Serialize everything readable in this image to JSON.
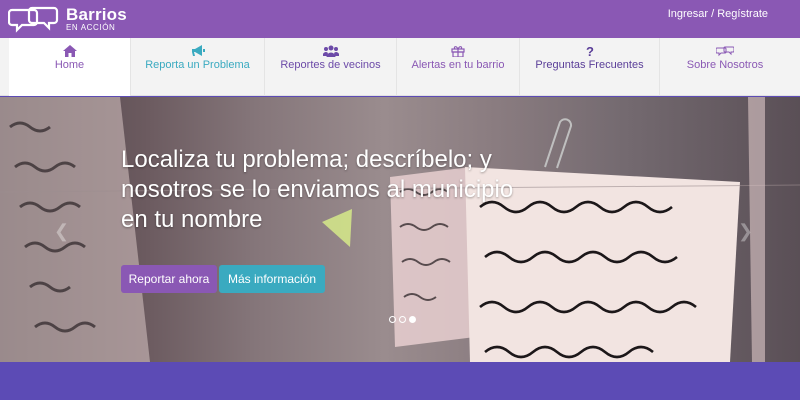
{
  "header": {
    "logo_name": "Barrios",
    "logo_sub": "EN ACCIÓN",
    "auth_link": "Ingresar / Regístrate"
  },
  "nav": {
    "items": [
      {
        "label": "Home",
        "icon": "home-icon"
      },
      {
        "label": "Reporta un Problema",
        "icon": "megaphone-icon"
      },
      {
        "label": "Reportes de vecinos",
        "icon": "users-icon"
      },
      {
        "label": "Alertas en tu barrio",
        "icon": "gift-icon"
      },
      {
        "label": "Preguntas Frecuentes",
        "icon": "question-icon"
      },
      {
        "label": "Sobre Nosotros",
        "icon": "chat-bubbles-icon"
      }
    ]
  },
  "hero": {
    "headline": "Localiza tu problema; descríbelo; y nosotros se lo enviamos al municipio en tu nombre",
    "report_button": "Reportar ahora",
    "info_button": "Más información",
    "slides": 3,
    "active_slide": 3
  },
  "colors": {
    "brand_purple": "#8a58b4",
    "accent_teal": "#3aaac0",
    "nav_bg": "#f3f3f3",
    "footer_band": "#5c4bb5"
  }
}
